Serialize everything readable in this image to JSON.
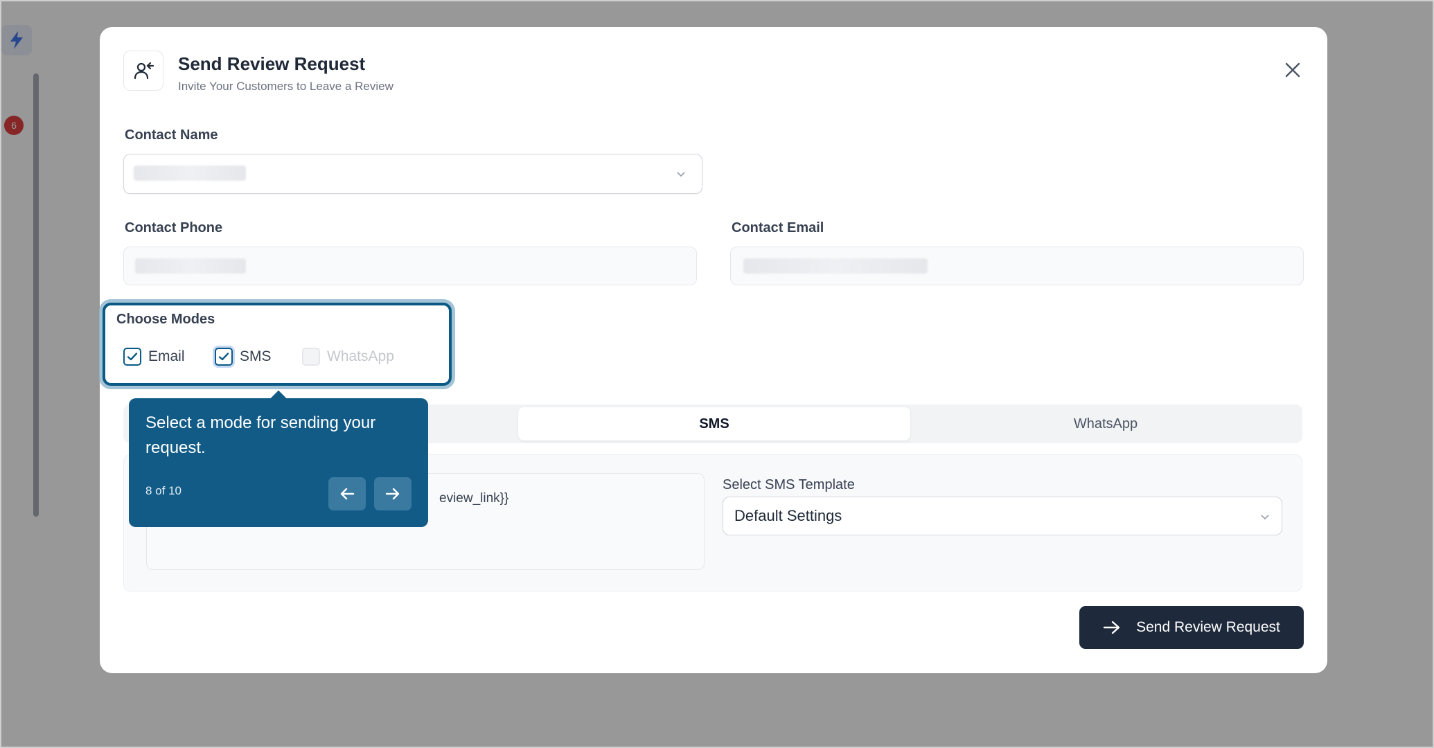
{
  "background": {
    "badge_count": "6"
  },
  "modal": {
    "title": "Send Review Request",
    "subtitle": "Invite Your Customers to Leave a Review",
    "icon": "user-plus-icon"
  },
  "fields": {
    "contact_name_label": "Contact Name",
    "contact_phone_label": "Contact Phone",
    "contact_email_label": "Contact Email"
  },
  "modes": {
    "label": "Choose Modes",
    "items": [
      {
        "label": "Email",
        "checked": true,
        "disabled": false
      },
      {
        "label": "SMS",
        "checked": true,
        "disabled": false
      },
      {
        "label": "WhatsApp",
        "checked": false,
        "disabled": true
      }
    ]
  },
  "tabs": {
    "sms": "SMS",
    "whatsapp": "WhatsApp",
    "active": "SMS"
  },
  "sms_panel": {
    "message_fragment": "eview_link}}",
    "template_label": "Select SMS Template",
    "template_value": "Default Settings"
  },
  "send_button": {
    "label": "Send Review Request"
  },
  "tooltip": {
    "text": "Select a mode for sending your request.",
    "step": "8 of 10"
  },
  "colors": {
    "accent": "#115b86",
    "primary_button": "#1e293b",
    "badge": "#dc2626"
  }
}
